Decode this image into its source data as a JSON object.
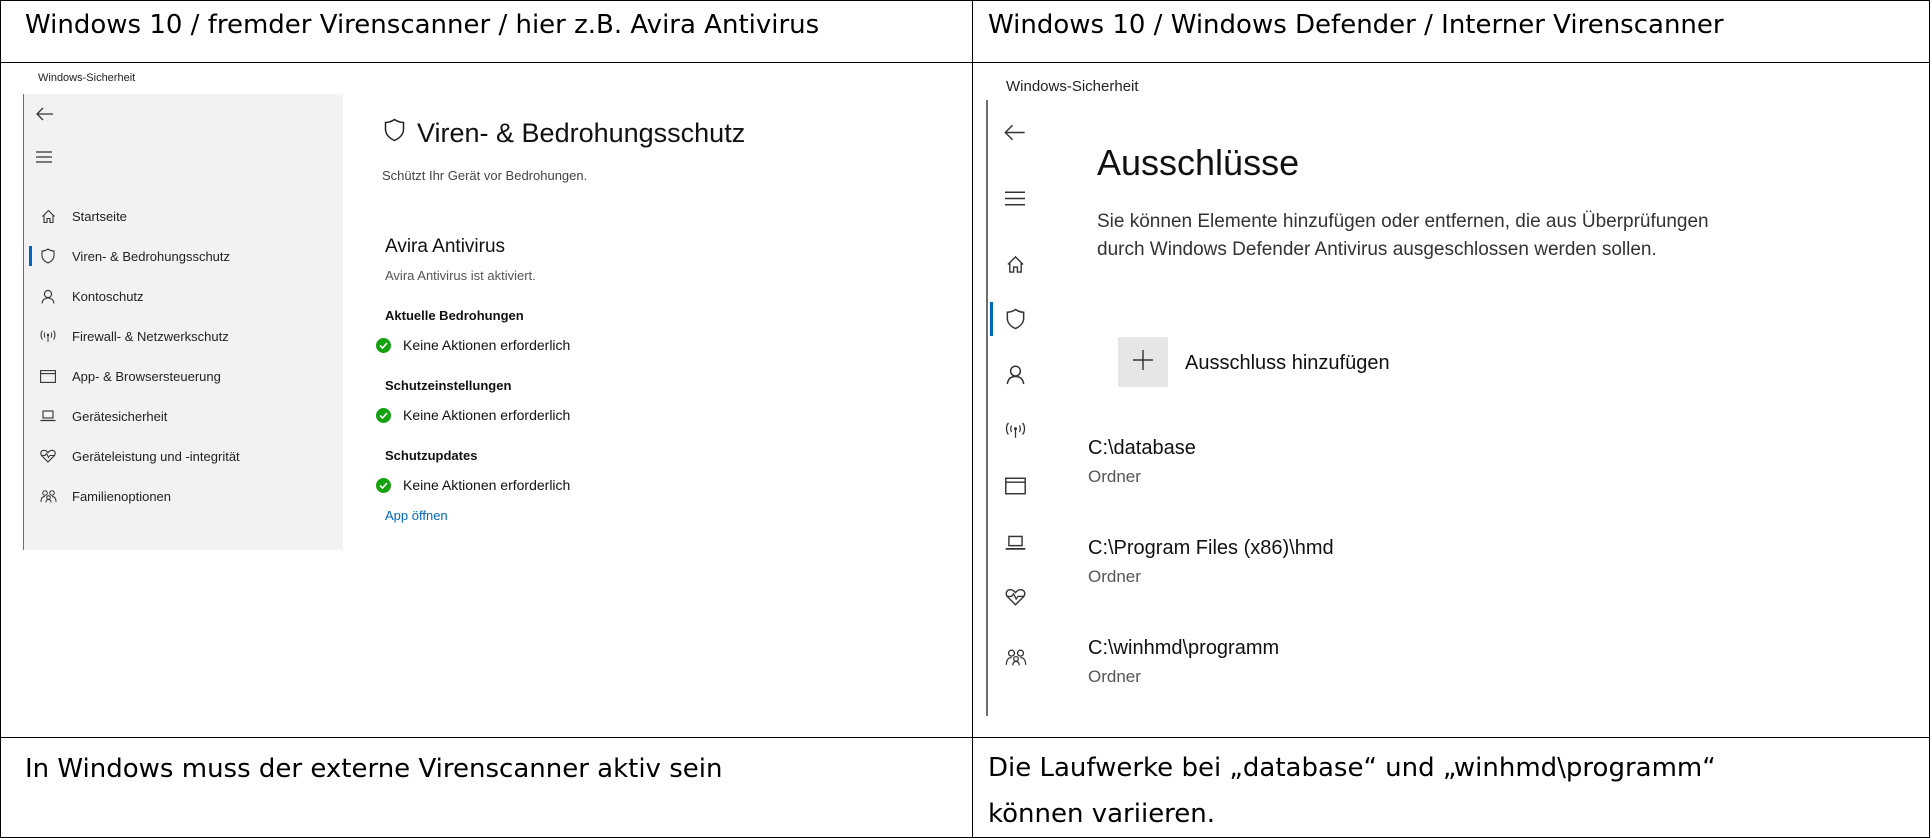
{
  "table": {
    "header_left": "Windows 10 / fremder Virenscanner / hier z.B. Avira Antivirus",
    "header_right": "Windows 10 / Windows Defender / Interner Virenscanner",
    "footer_left": "In Windows muss der externe Virenscanner aktiv sein",
    "footer_right_line1": "Die Laufwerke bei „database“ und „winhmd\\programm“",
    "footer_right_line2": "können variieren."
  },
  "left_app": {
    "window_title": "Windows-Sicherheit",
    "nav": [
      {
        "label": "Startseite",
        "icon": "home-icon"
      },
      {
        "label": "Viren- & Bedrohungsschutz",
        "icon": "shield-icon",
        "active": true
      },
      {
        "label": "Kontoschutz",
        "icon": "person-icon"
      },
      {
        "label": "Firewall- & Netzwerkschutz",
        "icon": "antenna-icon"
      },
      {
        "label": "App- & Browsersteuerung",
        "icon": "window-icon"
      },
      {
        "label": "Gerätesicherheit",
        "icon": "laptop-icon"
      },
      {
        "label": "Geräteleistung und -integrität",
        "icon": "heart-icon"
      },
      {
        "label": "Familienoptionen",
        "icon": "family-icon"
      }
    ],
    "page_title": "Viren- & Bedrohungsschutz",
    "page_subtitle": "Schützt Ihr Gerät vor Bedrohungen.",
    "provider_name": "Avira Antivirus",
    "provider_status": "Avira Antivirus ist aktiviert.",
    "sections": [
      {
        "heading": "Aktuelle Bedrohungen",
        "status": "Keine Aktionen erforderlich"
      },
      {
        "heading": "Schutzeinstellungen",
        "status": "Keine Aktionen erforderlich"
      },
      {
        "heading": "Schutzupdates",
        "status": "Keine Aktionen erforderlich"
      }
    ],
    "open_app_link": "App öffnen",
    "status_color": "#13a10e",
    "link_color": "#0067c0"
  },
  "right_app": {
    "window_title": "Windows-Sicherheit",
    "page_title": "Ausschlüsse",
    "description_line1": "Sie können Elemente hinzufügen oder entfernen, die aus Überprüfungen",
    "description_line2": "durch Windows Defender Antivirus ausgeschlossen werden sollen.",
    "add_button_label": "Ausschluss hinzufügen",
    "exclusions": [
      {
        "path": "C:\\database",
        "type": "Ordner"
      },
      {
        "path": "C:\\Program Files (x86)\\hmd",
        "type": "Ordner"
      },
      {
        "path": "C:\\winhmd\\programm",
        "type": "Ordner"
      }
    ]
  }
}
